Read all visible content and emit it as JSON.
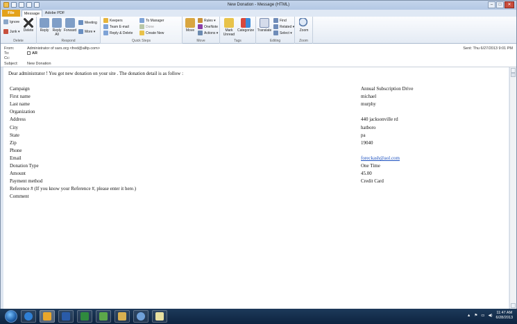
{
  "window": {
    "title": "New Donation - Message (HTML)",
    "controls": [
      "–",
      "□",
      "✕"
    ]
  },
  "tabs": [
    {
      "label": "File"
    },
    {
      "label": "Message"
    },
    {
      "label": "Adobe PDF"
    }
  ],
  "ribbon": {
    "delete": {
      "label": "Delete",
      "ignore": "Ignore",
      "junk": "Junk ▾",
      "delete_btn": "Delete"
    },
    "respond": {
      "label": "Respond",
      "reply": "Reply",
      "reply_all": "Reply All",
      "forward": "Forward",
      "meeting": "Meeting",
      "more": "More ▾"
    },
    "quicksteps": {
      "label": "Quick Steps",
      "items": [
        "Keepers",
        "Team E-mail",
        "Reply & Delete",
        "To Manager",
        "Done",
        "Create New"
      ]
    },
    "move": {
      "label": "Move",
      "move_btn": "Move",
      "rules": "Rules ▾",
      "onenote": "OneNote",
      "actions": "Actions ▾"
    },
    "tags": {
      "label": "Tags",
      "mark_unread": "Mark Unread",
      "categorize": "Categorize"
    },
    "editing": {
      "label": "Editing",
      "translate": "Translate",
      "find": "Find",
      "related": "Related ▾",
      "select": "Select ▾"
    },
    "zoom": {
      "label": "Zoom",
      "zoom_btn": "Zoom"
    }
  },
  "header": {
    "from_label": "From:",
    "from_value": "Administrator of sars.org <fred@alltp.com>",
    "to_label": "To:",
    "to_value": "AR",
    "cc_label": "Cc:",
    "cc_value": "",
    "subject_label": "Subject:",
    "subject_value": "New Donation",
    "sent": "Sent:   Thu 6/27/2013 9:01 PM"
  },
  "body": {
    "greeting": "Dear administrator ! You got new donation on your site . The donation detail is as follow :",
    "fields": [
      {
        "label": "Campaign",
        "value": "Annual Subscription Drive"
      },
      {
        "label": "First name",
        "value": "michael"
      },
      {
        "label": "Last name",
        "value": "murphy"
      },
      {
        "label": "Organization",
        "value": ""
      },
      {
        "label": "Address",
        "value": "440 jacksonville rd"
      },
      {
        "label": "City",
        "value": "hatboro"
      },
      {
        "label": "State",
        "value": "pa"
      },
      {
        "label": "Zip",
        "value": "19040"
      },
      {
        "label": "Phone",
        "value": ""
      },
      {
        "label": "Email",
        "value": "foreckash@aol.com"
      },
      {
        "label": "Donation Type",
        "value": "One Time"
      },
      {
        "label": "Amount",
        "value": "45.00"
      },
      {
        "label": "Payment method",
        "value": "Credit Card"
      },
      {
        "label": "Reference # (If you know your Reference #, please enter it here.)",
        "value": ""
      },
      {
        "label": "Comment",
        "value": ""
      }
    ]
  },
  "taskbar": {
    "time": "11:47 AM",
    "date": "6/28/2013"
  },
  "colors": {
    "file_tab": "#e3a21a",
    "taskbar": "#0e2440",
    "link": "#1a4fbf"
  }
}
